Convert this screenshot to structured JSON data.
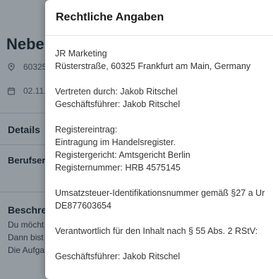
{
  "background_page": {
    "title": "Neben",
    "location": "60325",
    "date": "02.11.",
    "details_heading": "Details",
    "beruf_label": "Berufser",
    "beschreibung_heading": "Beschre",
    "description_lines": [
      "Du möcht",
      "Dann bist",
      "Die Aufga"
    ]
  },
  "modal": {
    "title": "Rechtliche Angaben",
    "company_name": "JR Marketing",
    "address": "Rüsterstraße, 60325 Frankfurt am Main, Germany",
    "represented_by": "Vertreten durch: Jakob Ritschel",
    "managing_director": "Geschäftsführer: Jakob Ritschel",
    "register_heading": "Registereintrag:",
    "register_entry": "Eintragung im Handelsregister.",
    "register_court": "Registergericht: Amtsgericht Berlin",
    "register_number": "Registernummer: HRB 4575145",
    "vat_label": "Umsatzsteuer-Identifikationsnummer gemäß §27 a Ur",
    "vat_number": "DE877603654",
    "responsible": "Verantwortlich für den Inhalt nach § 55 Abs. 2 RStV:",
    "responsible_director": "Geschäftsführer: Jakob Ritschel"
  },
  "colors": {
    "overlay": "#1e2a36",
    "modal_background": "#ffffff",
    "text": "#333333"
  },
  "icons": {
    "location": "map-pin-icon",
    "date": "calendar-icon"
  }
}
